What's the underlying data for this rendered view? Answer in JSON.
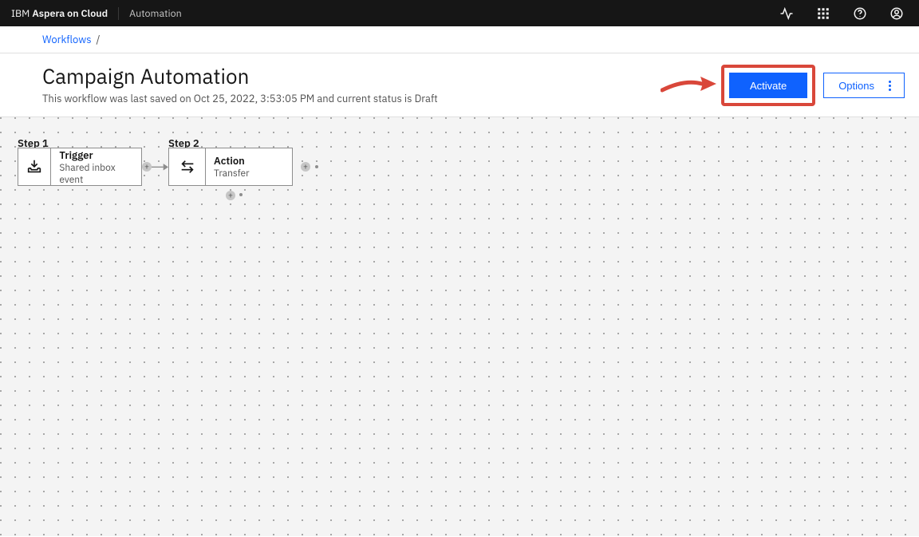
{
  "header": {
    "brand_prefix": "IBM",
    "brand_product": "Aspera on Cloud",
    "section": "Automation"
  },
  "breadcrumb": {
    "root": "Workflows",
    "separator": "/"
  },
  "page": {
    "title": "Campaign Automation",
    "subtitle": "This workflow was last saved on Oct 25, 2022, 3:53:05 PM and current status is Draft",
    "activate_label": "Activate",
    "options_label": "Options"
  },
  "canvas": {
    "steps": [
      {
        "label": "Step 1",
        "title": "Trigger",
        "subtitle": "Shared inbox event",
        "icon": "inbox-download"
      },
      {
        "label": "Step 2",
        "title": "Action",
        "subtitle": "Transfer",
        "icon": "transfer-arrows"
      }
    ]
  }
}
